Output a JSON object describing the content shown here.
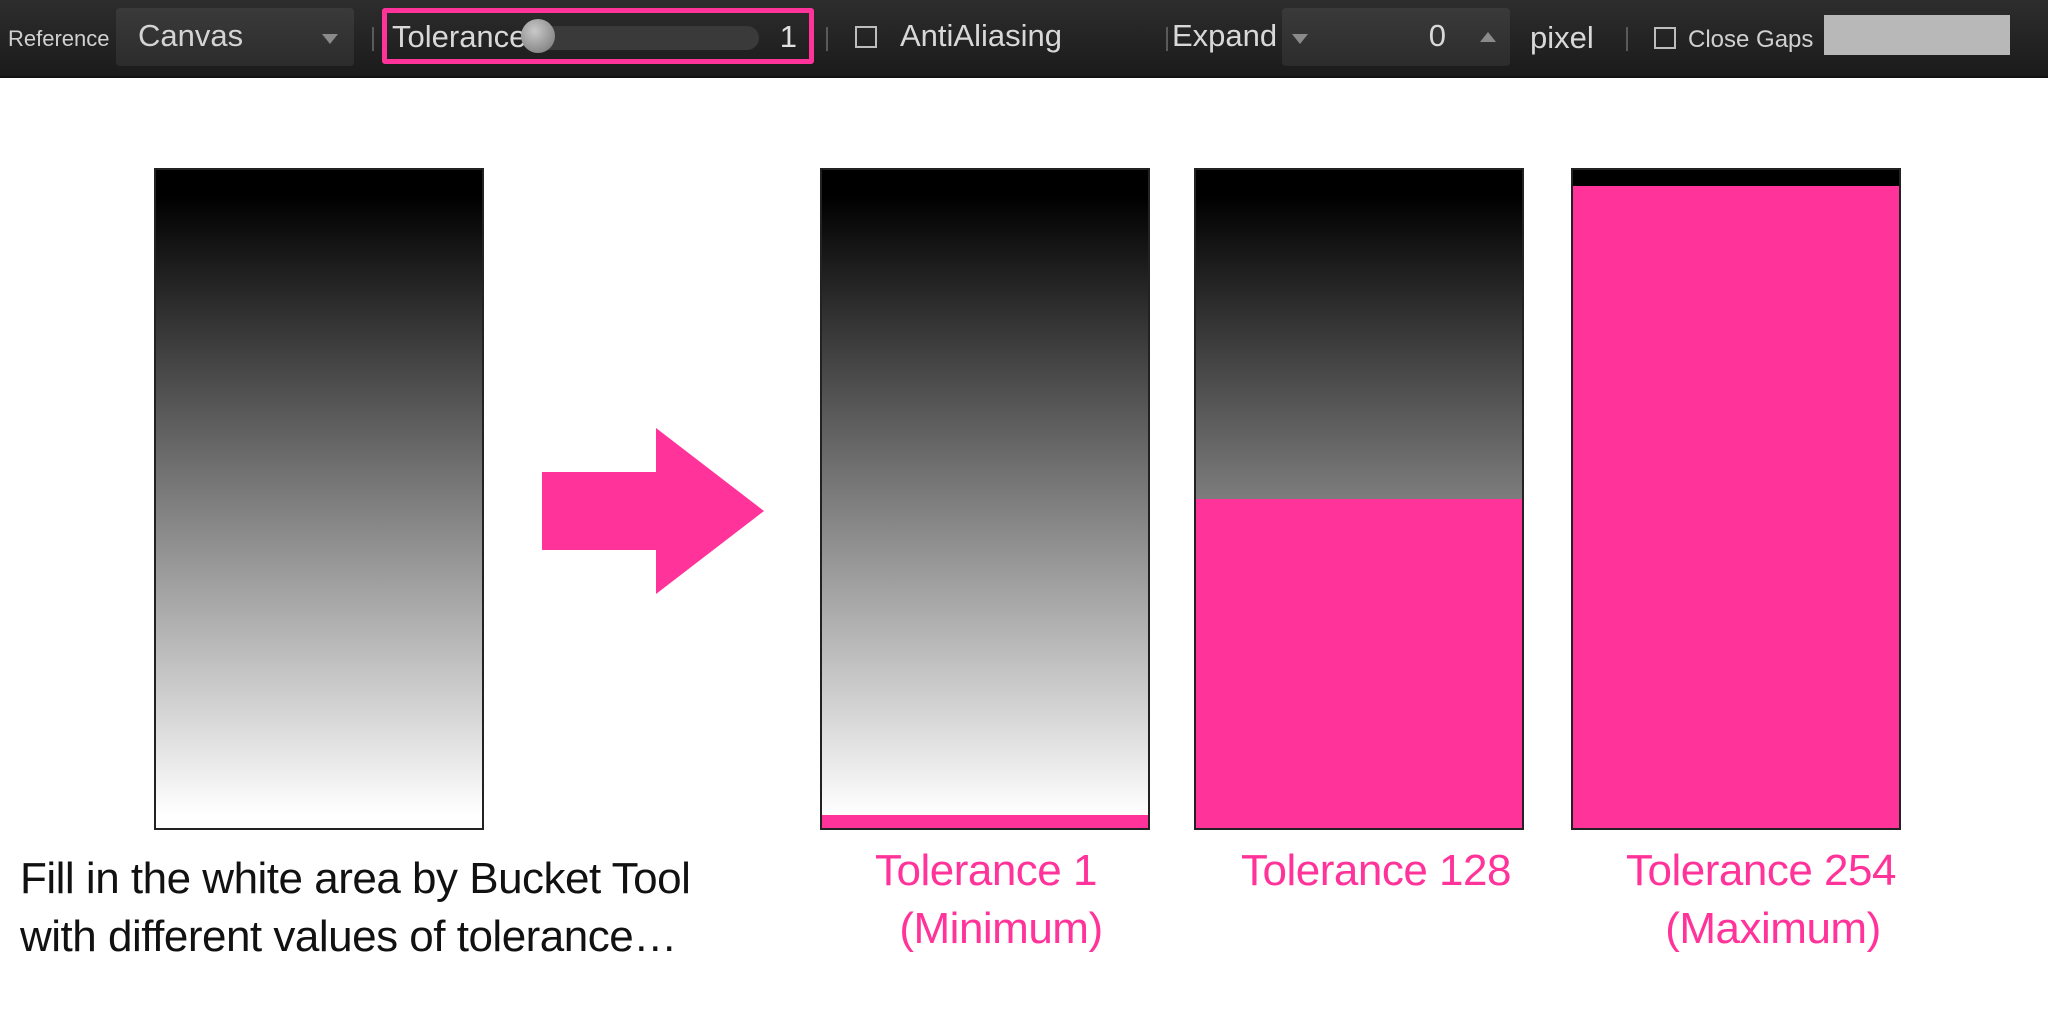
{
  "toolbar": {
    "reference_label": "Reference",
    "reference_value": "Canvas",
    "tolerance_label": "Tolerance",
    "tolerance_value": "1",
    "tolerance_level": 0.01,
    "antialiasing_label": "AntiAliasing",
    "expand_label": "Expand",
    "expand_value": "0",
    "expand_unit": "pixel",
    "close_gaps_label": "Close Gaps",
    "highlight_color": "#ff3399"
  },
  "illustration": {
    "caption_line1": "Fill in the white area by Bucket Tool",
    "caption_line2": "with different values of tolerance…",
    "fill_color": "#ff3399",
    "results": [
      {
        "label_line1": "Tolerance 1",
        "label_line2": "(Minimum)",
        "filled_fraction": 0.02
      },
      {
        "label_line1": "Tolerance 128",
        "label_line2": "",
        "filled_fraction": 0.5
      },
      {
        "label_line1": "Tolerance 254",
        "label_line2": "(Maximum)",
        "filled_fraction": 0.975
      }
    ]
  },
  "icons": [
    "dropdown-arrow-icon",
    "slider-knob-icon",
    "checkbox-icon",
    "spin-up-icon",
    "spin-down-icon",
    "right-arrow-icon"
  ]
}
